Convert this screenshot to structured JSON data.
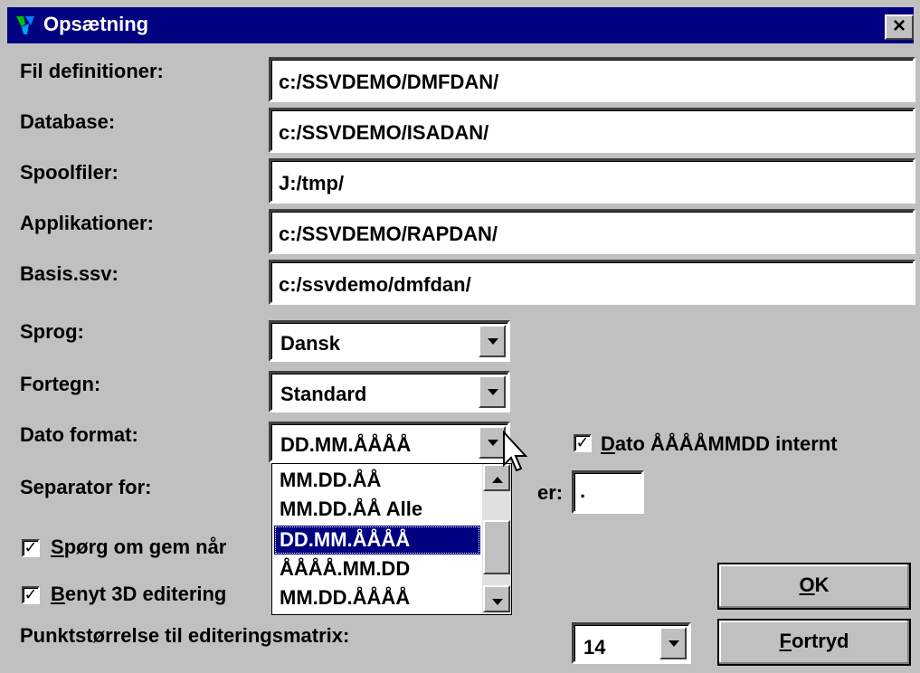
{
  "window": {
    "title": "Opsætning",
    "close_label": "×"
  },
  "paths": [
    {
      "label": "Fil definitioner:",
      "value": "c:/SSVDEMO/DMFDAN/"
    },
    {
      "label": "Database:",
      "value": "c:/SSVDEMO/ISADAN/"
    },
    {
      "label": "Spoolfiler:",
      "value": "J:/tmp/"
    },
    {
      "label": "Applikationer:",
      "value": "c:/SSVDEMO/RAPDAN/"
    },
    {
      "label": "Basis.ssv:",
      "value": "c:/ssvdemo/dmfdan/"
    }
  ],
  "sprog": {
    "label": "Sprog:",
    "value": "Dansk"
  },
  "fortegn": {
    "label": "Fortegn:",
    "value": "Standard"
  },
  "dato_format": {
    "label": "Dato format:",
    "value": "DD.MM.ÅÅÅÅ",
    "options": [
      "MM.DD.ÅÅ",
      "MM.DD.ÅÅ Alle",
      "DD.MM.ÅÅÅÅ",
      "ÅÅÅÅ.MM.DD",
      "MM.DD.ÅÅÅÅ"
    ],
    "selected_index": 2
  },
  "dato_internt": {
    "checked": true,
    "label_prefix": "",
    "label_u": "D",
    "label_rest": "ato ÅÅÅÅMMDD internt"
  },
  "separator": {
    "label": "Separator for:",
    "label_tail": "er:",
    "value": "."
  },
  "sporg_gem": {
    "checked": true,
    "label_u": "S",
    "label_rest": "pørg om gem når"
  },
  "benyt_3d": {
    "checked": true,
    "label_u": "B",
    "label_rest": "enyt 3D editering"
  },
  "punktstorrelse": {
    "label": "Punktstørrelse til editeringsmatrix:",
    "value": "14"
  },
  "buttons": {
    "ok_u": "O",
    "ok_rest": "K",
    "cancel_u": "F",
    "cancel_rest": "ortryd"
  },
  "colors": {
    "titlebar": "#000080",
    "selection": "#000080",
    "face": "#c0c0c0"
  },
  "icons": {
    "app": "app-icon",
    "check": "✓"
  }
}
